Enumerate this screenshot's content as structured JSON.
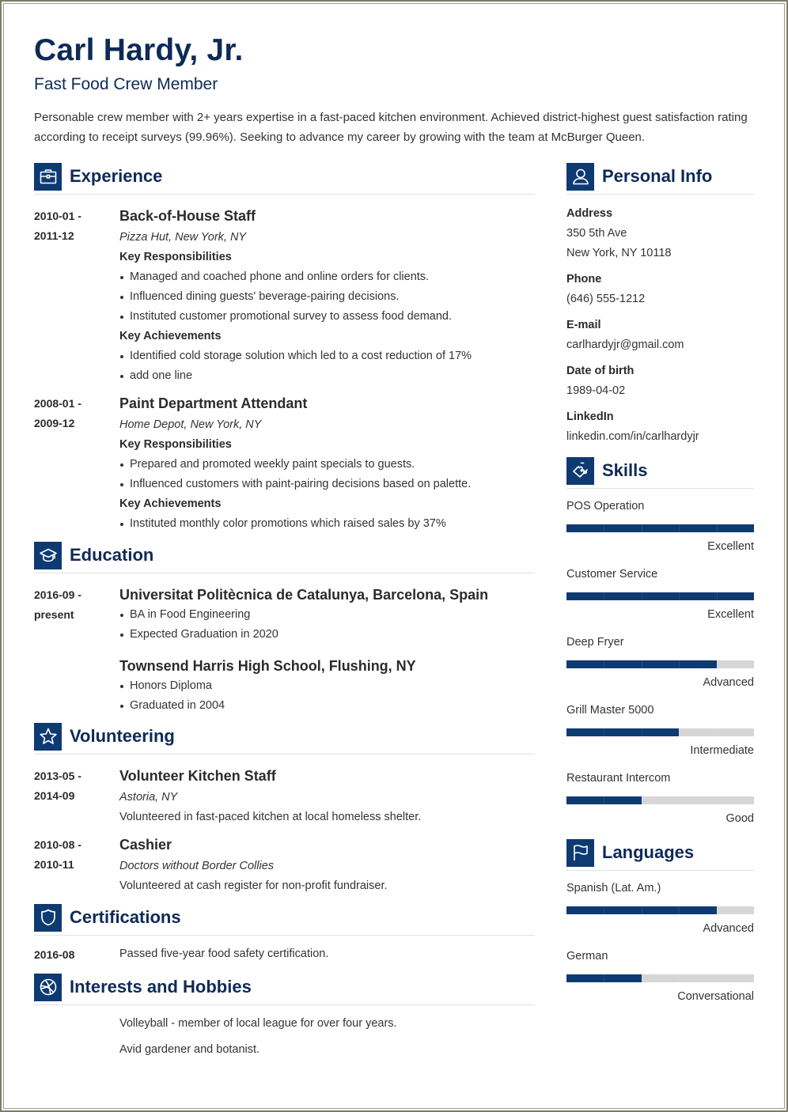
{
  "header": {
    "name": "Carl Hardy, Jr.",
    "title": "Fast Food Crew Member",
    "summary": "Personable crew member with 2+ years expertise in a fast-paced kitchen environment. Achieved district-highest guest satisfaction rating according to receipt surveys (99.96%). Seeking to advance my career by growing with the team at McBurger Queen."
  },
  "colors": {
    "accent": "#0e3a72",
    "heading": "#0e2a57",
    "bar_track": "#d6d6d6"
  },
  "experience": {
    "heading": "Experience",
    "icon": "briefcase-icon",
    "entries": [
      {
        "date_start": "2010-01 -",
        "date_end": "2011-12",
        "title": "Back-of-House Staff",
        "company": "Pizza Hut, New York, NY",
        "resp_label": "Key Responsibilities",
        "responsibilities": [
          "Managed and coached phone and online orders for clients.",
          "Influenced dining guests' beverage-pairing decisions.",
          "Instituted customer promotional survey to assess food demand."
        ],
        "ach_label": "Key Achievements",
        "achievements": [
          "Identified cold storage solution which led to a cost reduction of 17%",
          "add one line"
        ]
      },
      {
        "date_start": "2008-01 -",
        "date_end": "2009-12",
        "title": "Paint Department Attendant",
        "company": "Home Depot, New York, NY",
        "resp_label": "Key Responsibilities",
        "responsibilities": [
          "Prepared and promoted weekly paint specials to guests.",
          "Influenced customers with paint-pairing decisions based on palette."
        ],
        "ach_label": "Key Achievements",
        "achievements": [
          "Instituted monthly color promotions which raised sales by 37%"
        ]
      }
    ]
  },
  "education": {
    "heading": "Education",
    "icon": "graduation-cap-icon",
    "entries": [
      {
        "date_start": "2016-09 -",
        "date_end": "present",
        "school": "Universitat Politècnica de Catalunya, Barcelona, Spain",
        "details": [
          "BA in Food Engineering",
          "Expected Graduation in 2020"
        ]
      },
      {
        "date_start": "",
        "date_end": "",
        "school": "Townsend Harris High School, Flushing, NY",
        "details": [
          "Honors Diploma",
          "Graduated in 2004"
        ]
      }
    ]
  },
  "volunteering": {
    "heading": "Volunteering",
    "icon": "star-icon",
    "entries": [
      {
        "date_start": "2013-05 -",
        "date_end": "2014-09",
        "title": "Volunteer Kitchen Staff",
        "org": "Astoria, NY",
        "description": "Volunteered in fast-paced kitchen at local homeless shelter."
      },
      {
        "date_start": "2010-08 -",
        "date_end": "2010-11",
        "title": "Cashier",
        "org": "Doctors without Border Collies",
        "description": "Volunteered at cash register for non-profit fundraiser."
      }
    ]
  },
  "certifications": {
    "heading": "Certifications",
    "icon": "shield-icon",
    "entries": [
      {
        "date": "2016-08",
        "text": "Passed five-year food safety certification."
      }
    ]
  },
  "interests": {
    "heading": "Interests and Hobbies",
    "icon": "basketball-icon",
    "items": [
      "Volleyball - member of local league for over four years.",
      "Avid gardener and botanist."
    ]
  },
  "personal_info": {
    "heading": "Personal Info",
    "icon": "user-icon",
    "fields": [
      {
        "label": "Address",
        "values": [
          "350 5th Ave",
          "New York, NY 10118"
        ]
      },
      {
        "label": "Phone",
        "values": [
          "(646) 555-1212"
        ]
      },
      {
        "label": "E-mail",
        "values": [
          "carlhardyjr@gmail.com"
        ]
      },
      {
        "label": "Date of birth",
        "values": [
          "1989-04-02"
        ]
      },
      {
        "label": "LinkedIn",
        "values": [
          "linkedin.com/in/carlhardyjr"
        ]
      }
    ]
  },
  "skills": {
    "heading": "Skills",
    "icon": "puzzle-piece-icon",
    "items": [
      {
        "name": "POS Operation",
        "level": "Excellent",
        "rating": 5,
        "max": 5
      },
      {
        "name": "Customer Service",
        "level": "Excellent",
        "rating": 5,
        "max": 5
      },
      {
        "name": "Deep Fryer",
        "level": "Advanced",
        "rating": 4,
        "max": 5
      },
      {
        "name": "Grill Master 5000",
        "level": "Intermediate",
        "rating": 3,
        "max": 5
      },
      {
        "name": "Restaurant Intercom",
        "level": "Good",
        "rating": 2,
        "max": 5
      }
    ]
  },
  "languages": {
    "heading": "Languages",
    "icon": "flag-icon",
    "items": [
      {
        "name": "Spanish (Lat. Am.)",
        "level": "Advanced",
        "rating": 4,
        "max": 5
      },
      {
        "name": "German",
        "level": "Conversational",
        "rating": 2,
        "max": 5
      }
    ]
  }
}
